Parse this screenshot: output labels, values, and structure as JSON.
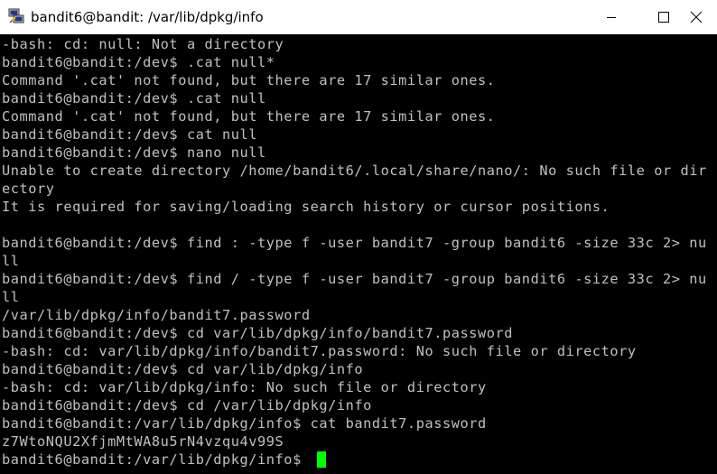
{
  "window": {
    "title": "bandit6@bandit: /var/lib/dpkg/info",
    "app_icon": "putty-icon",
    "controls": [
      "minimize-icon",
      "maximize-icon",
      "close-icon"
    ]
  },
  "terminal": {
    "lines": [
      "-bash: cd: null: Not a directory",
      "bandit6@bandit:/dev$ .cat null*",
      "Command '.cat' not found, but there are 17 similar ones.",
      "bandit6@bandit:/dev$ .cat null",
      "Command '.cat' not found, but there are 17 similar ones.",
      "bandit6@bandit:/dev$ cat null",
      "bandit6@bandit:/dev$ nano null",
      "Unable to create directory /home/bandit6/.local/share/nano/: No such file or dir",
      "ectory",
      "It is required for saving/loading search history or cursor positions.",
      "",
      "bandit6@bandit:/dev$ find : -type f -user bandit7 -group bandit6 -size 33c 2> nu",
      "ll",
      "bandit6@bandit:/dev$ find / -type f -user bandit7 -group bandit6 -size 33c 2> nu",
      "ll",
      "/var/lib/dpkg/info/bandit7.password",
      "bandit6@bandit:/dev$ cd var/lib/dpkg/info/bandit7.password",
      "-bash: cd: var/lib/dpkg/info/bandit7.password: No such file or directory",
      "bandit6@bandit:/dev$ cd var/lib/dpkg/info",
      "-bash: cd: var/lib/dpkg/info: No such file or directory",
      "bandit6@bandit:/dev$ cd /var/lib/dpkg/info",
      "bandit6@bandit:/var/lib/dpkg/info$ cat bandit7.password",
      "z7WtoNQU2XfjmMtWA8u5rN4vzqu4v99S",
      "bandit6@bandit:/var/lib/dpkg/info$ "
    ],
    "text_color": "#c0c0c0",
    "background": "#000000",
    "cursor_color": "#00ff00"
  }
}
